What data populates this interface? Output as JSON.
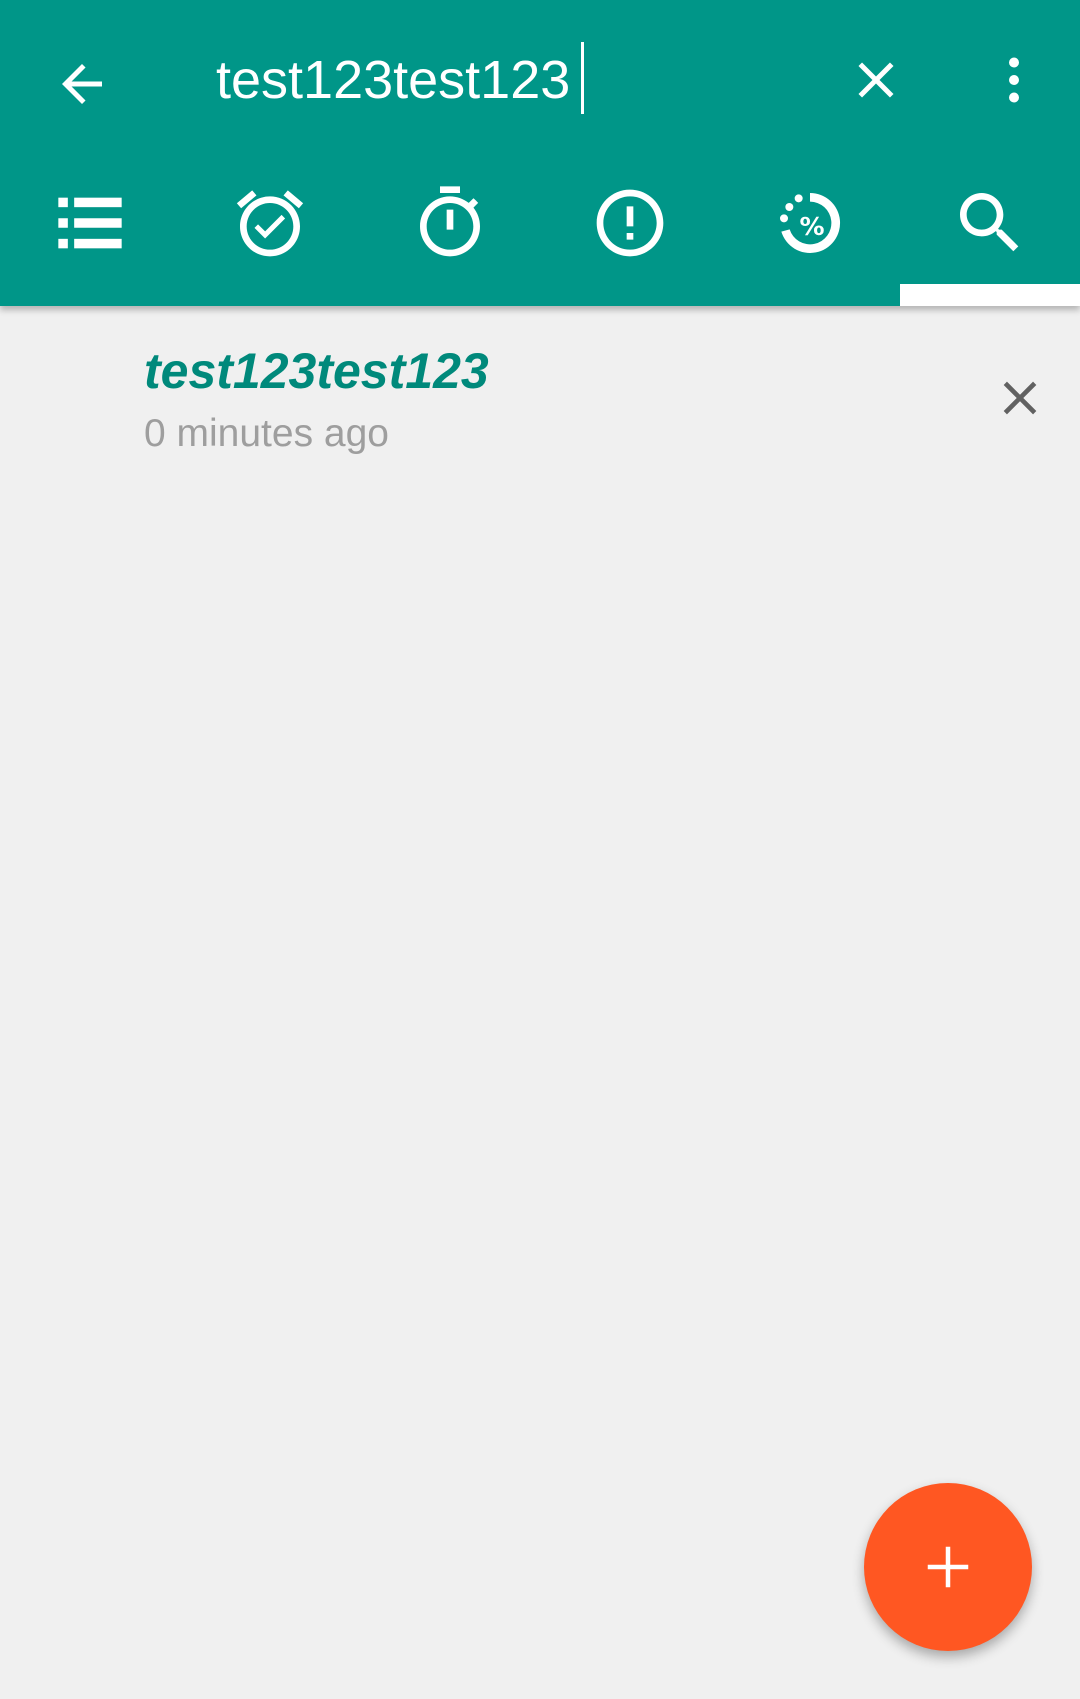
{
  "colors": {
    "primary": "#009688",
    "accent": "#ff5722",
    "title_text": "#00897b",
    "secondary_text": "#9e9e9e",
    "background": "#f0f0f0"
  },
  "toolbar": {
    "back_icon": "arrow-back-icon",
    "search_value": "test123test123",
    "clear_icon": "close-icon",
    "more_icon": "more-vertical-icon"
  },
  "tabs": [
    {
      "icon": "list-icon",
      "active": false
    },
    {
      "icon": "alarm-check-icon",
      "active": false
    },
    {
      "icon": "timer-icon",
      "active": false
    },
    {
      "icon": "alert-circle-icon",
      "active": false
    },
    {
      "icon": "progress-percent-icon",
      "active": false
    },
    {
      "icon": "search-icon",
      "active": true
    }
  ],
  "results": [
    {
      "title": "test123test123",
      "subtitle": "0 minutes ago",
      "remove_icon": "close-icon"
    }
  ],
  "fab": {
    "icon": "plus-icon"
  }
}
